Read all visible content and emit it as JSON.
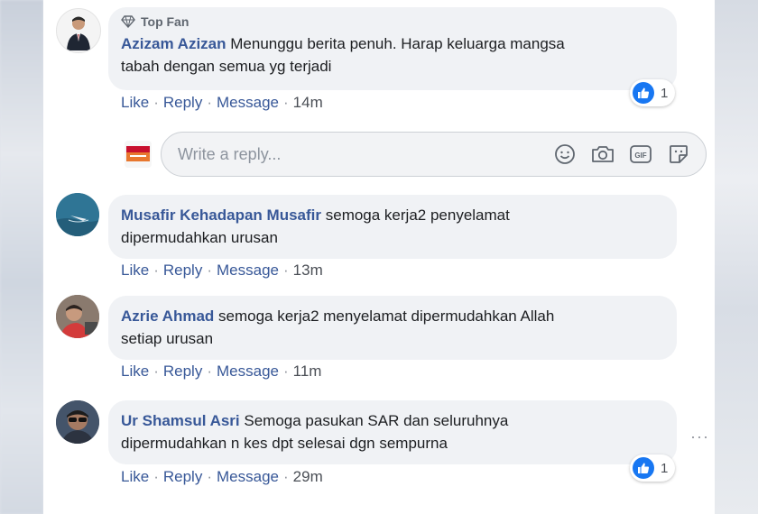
{
  "colors": {
    "link_blue": "#385898",
    "bubble_bg": "#f0f2f5",
    "like_blue": "#1877f2"
  },
  "action_labels": {
    "like": "Like",
    "reply": "Reply",
    "message": "Message",
    "separator": "·"
  },
  "comments": [
    {
      "badge": "Top Fan",
      "badge_icon": "diamond-icon",
      "author": "Azizam Azizan",
      "text_line1": "Menunggu berita penuh. Harap keluarga mangsa",
      "text_line2": "tabah dengan semua yg terjadi",
      "time": "14m",
      "reaction_icon": "like-icon",
      "reaction_count": "1"
    },
    {
      "author": "Musafir Kehadapan Musafir",
      "text_line1": "semoga kerja2 penyelamat",
      "text_line2": "dipermudahkan urusan",
      "time": "13m"
    },
    {
      "author": "Azrie Ahmad",
      "text_line1": "semoga kerja2 menyelamat dipermudahkan Allah",
      "text_line2": "setiap urusan",
      "time": "11m"
    },
    {
      "author": "Ur Shamsul Asri",
      "text_line1": "Semoga pasukan SAR dan seluruhnya",
      "text_line2": "dipermudahkan n kes dpt selesai dgn sempurna",
      "time": "29m",
      "reaction_icon": "like-icon",
      "reaction_count": "1",
      "more_label": "···"
    }
  ],
  "reply_box": {
    "placeholder": "Write a reply...",
    "icons": [
      "emoji-icon",
      "camera-icon",
      "gif-icon",
      "sticker-icon"
    ],
    "gif_label": "GIF"
  }
}
